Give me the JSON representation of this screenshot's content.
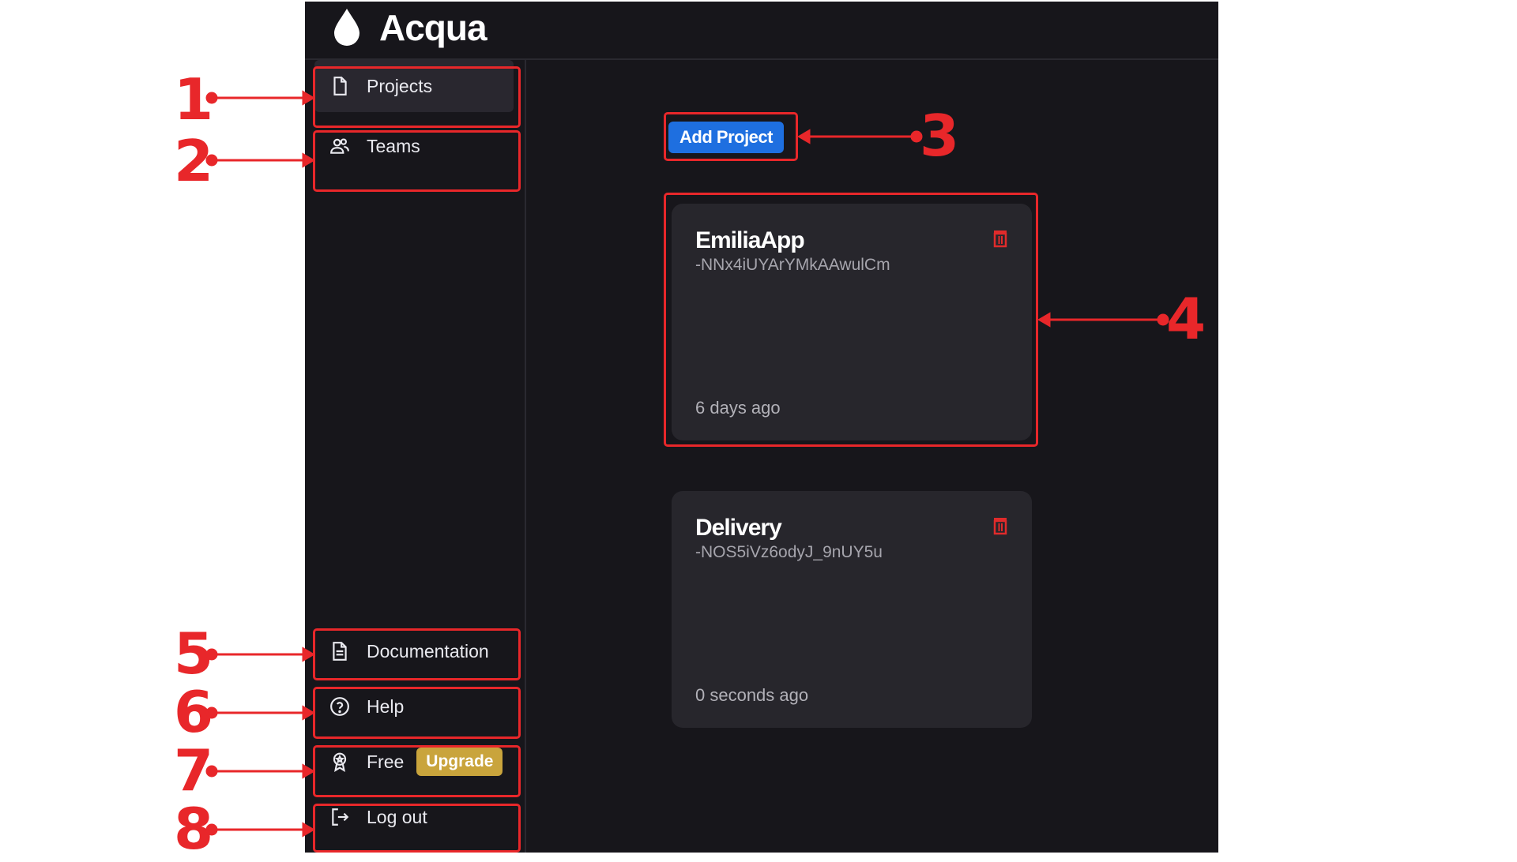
{
  "app": {
    "name": "Acqua"
  },
  "sidebar": {
    "items": [
      {
        "label": "Projects",
        "icon": "file-icon"
      },
      {
        "label": "Teams",
        "icon": "users-icon"
      },
      {
        "label": "Documentation",
        "icon": "document-icon"
      },
      {
        "label": "Help",
        "icon": "help-circle-icon"
      },
      {
        "label": "Free",
        "icon": "award-icon",
        "badge": "Upgrade"
      },
      {
        "label": "Log out",
        "icon": "logout-icon"
      }
    ]
  },
  "main": {
    "add_project_label": "Add Project",
    "projects": [
      {
        "name": "EmiliaApp",
        "id": "-NNx4iUYArYMkAAwulCm",
        "updated": "6 days ago"
      },
      {
        "name": "Delivery",
        "id": "-NOS5iVz6odyJ_9nUY5u",
        "updated": "0 seconds ago"
      }
    ]
  },
  "annotations": [
    "1",
    "2",
    "3",
    "4",
    "5",
    "6",
    "7",
    "8"
  ],
  "colors": {
    "background": "#17161b",
    "card": "#27262c",
    "accent": "#1e6fe0",
    "upgrade": "#c9a43c",
    "delete": "#e02b2b",
    "annotation": "#e8272a"
  }
}
